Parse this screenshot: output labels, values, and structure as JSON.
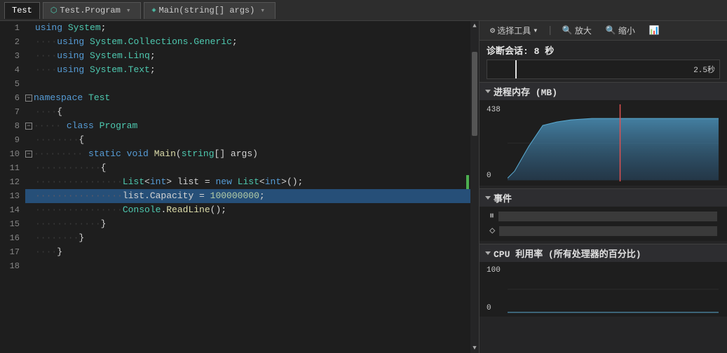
{
  "topbar": {
    "tabs": [
      {
        "id": "test",
        "label": "Test",
        "icon": "file-icon",
        "active": false
      },
      {
        "id": "test-program",
        "label": "Test.Program",
        "icon": "class-icon",
        "active": false
      },
      {
        "id": "main-args",
        "label": "Main(string[] args)",
        "icon": "method-icon",
        "active": false
      }
    ]
  },
  "editor": {
    "lines": [
      {
        "num": 1,
        "content": "using System;",
        "tokens": [
          {
            "t": "kw",
            "v": "using"
          },
          {
            "t": "plain",
            "v": " "
          },
          {
            "t": "ns",
            "v": "System"
          },
          {
            "t": "plain",
            "v": ";"
          }
        ]
      },
      {
        "num": 2,
        "content": "    using System.Collections.Generic;",
        "indent": "    ",
        "tokens": [
          {
            "t": "kw",
            "v": "using"
          },
          {
            "t": "plain",
            "v": " "
          },
          {
            "t": "ns",
            "v": "System.Collections.Generic"
          },
          {
            "t": "plain",
            "v": ";"
          }
        ]
      },
      {
        "num": 3,
        "content": "    using System.Linq;",
        "indent": "    ",
        "tokens": [
          {
            "t": "kw",
            "v": "using"
          },
          {
            "t": "plain",
            "v": " "
          },
          {
            "t": "ns",
            "v": "System.Linq"
          },
          {
            "t": "plain",
            "v": ";"
          }
        ]
      },
      {
        "num": 4,
        "content": "    using System.Text;",
        "indent": "    ",
        "tokens": [
          {
            "t": "kw",
            "v": "using"
          },
          {
            "t": "plain",
            "v": " "
          },
          {
            "t": "ns",
            "v": "System.Text"
          },
          {
            "t": "plain",
            "v": ";"
          }
        ]
      },
      {
        "num": 5,
        "content": "",
        "tokens": []
      },
      {
        "num": 6,
        "content": "namespace Test",
        "tokens": [
          {
            "t": "kw",
            "v": "namespace"
          },
          {
            "t": "plain",
            "v": " "
          },
          {
            "t": "type",
            "v": "Test"
          }
        ],
        "collapsible": true,
        "collapsed": false
      },
      {
        "num": 7,
        "content": "    {",
        "indent": "    ",
        "tokens": [
          {
            "t": "plain",
            "v": "{"
          }
        ]
      },
      {
        "num": 8,
        "content": "        class Program",
        "tokens": [
          {
            "t": "kw",
            "v": "class"
          },
          {
            "t": "plain",
            "v": " "
          },
          {
            "t": "type",
            "v": "Program"
          }
        ],
        "collapsible": true,
        "collapsed": false,
        "indent_level": 2
      },
      {
        "num": 9,
        "content": "        {",
        "indent": "        ",
        "tokens": [
          {
            "t": "plain",
            "v": "{"
          }
        ]
      },
      {
        "num": 10,
        "content": "            static void Main(string[] args)",
        "tokens": [
          {
            "t": "kw",
            "v": "static"
          },
          {
            "t": "plain",
            "v": " "
          },
          {
            "t": "kw",
            "v": "void"
          },
          {
            "t": "plain",
            "v": " "
          },
          {
            "t": "method",
            "v": "Main"
          },
          {
            "t": "plain",
            "v": "("
          },
          {
            "t": "type",
            "v": "string"
          },
          {
            "t": "plain",
            "v": "[] args)"
          }
        ],
        "collapsible": true,
        "collapsed": false,
        "indent_level": 3
      },
      {
        "num": 11,
        "content": "            {",
        "indent": "            ",
        "tokens": [
          {
            "t": "plain",
            "v": "{"
          }
        ]
      },
      {
        "num": 12,
        "content": "                List<int> list = new List<int>();",
        "tokens": [
          {
            "t": "type",
            "v": "List"
          },
          {
            "t": "plain",
            "v": "<"
          },
          {
            "t": "kw",
            "v": "int"
          },
          {
            "t": "plain",
            "v": "> list = "
          },
          {
            "t": "kw",
            "v": "new"
          },
          {
            "t": "plain",
            "v": " "
          },
          {
            "t": "type",
            "v": "List"
          },
          {
            "t": "plain",
            "v": "<"
          },
          {
            "t": "kw",
            "v": "int"
          },
          {
            "t": "plain",
            "v": ">();"
          }
        ]
      },
      {
        "num": 13,
        "content": "                list.Capacity = 100000000;",
        "tokens": [
          {
            "t": "plain",
            "v": "list.Capacity = "
          },
          {
            "t": "num",
            "v": "100000000"
          },
          {
            "t": "plain",
            "v": ";"
          }
        ],
        "selected": true
      },
      {
        "num": 14,
        "content": "                Console.ReadLine();",
        "tokens": [
          {
            "t": "type",
            "v": "Console"
          },
          {
            "t": "plain",
            "v": "."
          },
          {
            "t": "method",
            "v": "ReadLine"
          },
          {
            "t": "plain",
            "v": "();"
          }
        ]
      },
      {
        "num": 15,
        "content": "            }",
        "indent": "            ",
        "tokens": [
          {
            "t": "plain",
            "v": "}"
          }
        ]
      },
      {
        "num": 16,
        "content": "        }",
        "indent": "        ",
        "tokens": [
          {
            "t": "plain",
            "v": "}"
          }
        ]
      },
      {
        "num": 17,
        "content": "    }",
        "indent": "    ",
        "tokens": [
          {
            "t": "plain",
            "v": "}"
          }
        ]
      },
      {
        "num": 18,
        "content": "",
        "tokens": []
      }
    ]
  },
  "right_panel": {
    "toolbar": {
      "select_tool_label": "选择工具",
      "zoom_in_label": "放大",
      "zoom_out_label": "缩小",
      "gear_icon": "⚙",
      "magnify_in_icon": "🔍",
      "magnify_out_icon": "🔍",
      "chart_icon": "📊"
    },
    "diag_header": "诊断会话: 8 秒",
    "timeline_label": "2.5秒",
    "sections": [
      {
        "id": "memory",
        "title": "进程内存 (MB)",
        "collapsed": false,
        "y_max": "438",
        "y_min": "0",
        "chart_type": "area"
      },
      {
        "id": "events",
        "title": "事件",
        "collapsed": false,
        "items": [
          {
            "icon": "⏸",
            "type": "pause"
          },
          {
            "icon": "◇",
            "type": "diamond"
          }
        ]
      },
      {
        "id": "cpu",
        "title": "CPU 利用率 (所有处理器的百分比)",
        "collapsed": false,
        "y_max": "100",
        "y_min": "0"
      }
    ]
  }
}
